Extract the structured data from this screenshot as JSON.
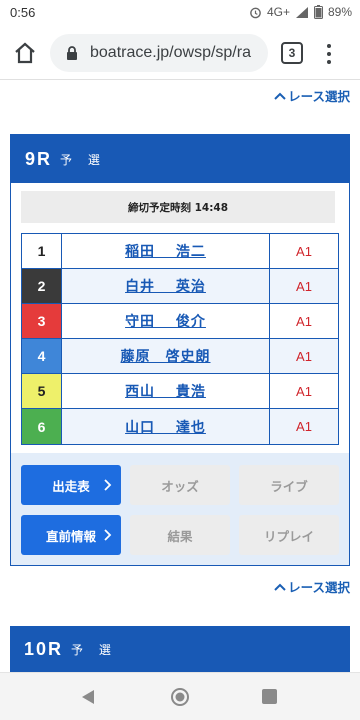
{
  "status": {
    "time": "0:56",
    "network": "4G+",
    "battery": "89%"
  },
  "browser": {
    "url": "boatrace.jp/owsp/sp/ra",
    "tab_count": "3"
  },
  "race_select_label": "レース選択",
  "race": {
    "number": "9R",
    "type": "予 選",
    "deadline": "締切予定時刻 14:48",
    "entries": [
      {
        "lane": "1",
        "name": "稲田　 浩二",
        "rank": "A1",
        "color": "#ffffff",
        "text_color": "#222222"
      },
      {
        "lane": "2",
        "name": "白井　 英治",
        "rank": "A1",
        "color": "#3a3a3a",
        "text_color": "#ffffff"
      },
      {
        "lane": "3",
        "name": "守田　 俊介",
        "rank": "A1",
        "color": "#e53b3b",
        "text_color": "#ffffff"
      },
      {
        "lane": "4",
        "name": "藤原　啓史朗",
        "rank": "A1",
        "color": "#3f86d8",
        "text_color": "#ffffff"
      },
      {
        "lane": "5",
        "name": "西山　 貴浩",
        "rank": "A1",
        "color": "#eef06a",
        "text_color": "#222222"
      },
      {
        "lane": "6",
        "name": "山口　 達也",
        "rank": "A1",
        "color": "#4caf50",
        "text_color": "#ffffff"
      }
    ],
    "buttons": {
      "entry_table": "出走表",
      "odds": "オッズ",
      "live": "ライブ",
      "pre_info": "直前情報",
      "result": "結果",
      "replay": "リプレイ"
    }
  },
  "next_race": {
    "number": "10R",
    "type": "予 選"
  },
  "colors": {
    "primary": "#1859b5",
    "button": "#1e6de0",
    "rank": "#d0242b"
  }
}
